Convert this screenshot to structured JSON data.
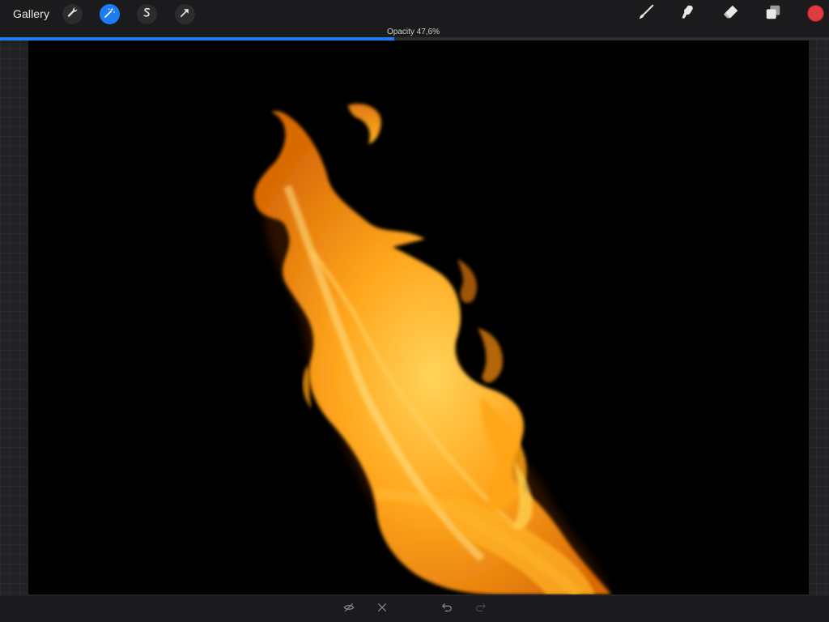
{
  "toolbar": {
    "gallery_label": "Gallery",
    "left_tools": [
      {
        "name": "actions",
        "icon": "wrench-icon",
        "active": false
      },
      {
        "name": "adjustments",
        "icon": "magic-wand-icon",
        "active": true
      },
      {
        "name": "selection",
        "icon": "selection-s-icon",
        "active": false
      },
      {
        "name": "transform",
        "icon": "arrow-cursor-icon",
        "active": false
      }
    ],
    "right_tools": [
      {
        "name": "brush",
        "icon": "brush-icon"
      },
      {
        "name": "smudge",
        "icon": "smudge-icon"
      },
      {
        "name": "eraser",
        "icon": "eraser-icon"
      },
      {
        "name": "layers",
        "icon": "layers-icon"
      }
    ],
    "color": "#e0393e",
    "accent": "#1b7cf3"
  },
  "opacity": {
    "label": "Opacity 47,6%",
    "value": 0.476
  },
  "canvas": {
    "background": "#000000",
    "content": "flame-artwork"
  },
  "bottom_bar": {
    "buttons": [
      {
        "name": "hide",
        "icon": "eye-slash-icon",
        "enabled": true
      },
      {
        "name": "cancel",
        "icon": "close-icon",
        "enabled": true
      },
      {
        "name": "undo",
        "icon": "undo-icon",
        "enabled": true
      },
      {
        "name": "redo",
        "icon": "redo-icon",
        "enabled": false
      }
    ]
  }
}
